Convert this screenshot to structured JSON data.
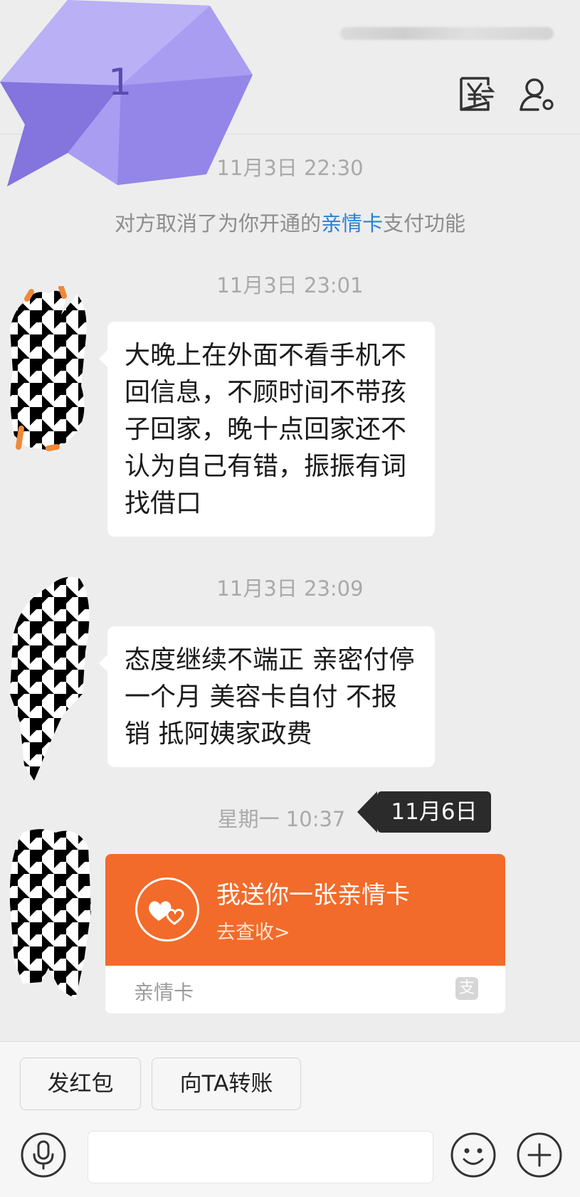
{
  "header": {
    "unread_count": "1",
    "transfer_icon": "yuan-transfer-icon",
    "profile_icon": "person-settings-icon"
  },
  "messages": [
    {
      "type": "timestamp",
      "text": "11月3日 22:30"
    },
    {
      "type": "system",
      "before": "对方取消了为你开通的",
      "link": "亲情卡",
      "after": "支付功能"
    },
    {
      "type": "timestamp",
      "text": "11月3日 23:01"
    },
    {
      "type": "text",
      "lines": [
        "大晚上在外面不看手机不",
        "回信息，不顾时间不带孩",
        "子回家，晚十点回家还不",
        "认为自己有错，振振有词",
        "找借口"
      ]
    },
    {
      "type": "timestamp",
      "text": "11月3日 23:09"
    },
    {
      "type": "text",
      "lines": [
        "态度继续不端正 亲密付停",
        "一个月   美容卡自付 不报",
        "销  抵阿姨家政费"
      ]
    },
    {
      "type": "timestamp",
      "text": "星期一 10:37"
    },
    {
      "type": "card",
      "title": "我送你一张亲情卡",
      "subtitle": "去查收>",
      "label": "亲情卡"
    }
  ],
  "tooltip": "11月6日",
  "bottom": {
    "red_packet_label": "发红包",
    "transfer_label": "向TA转账",
    "input_value": ""
  },
  "colors": {
    "card_orange": "#f26b2a",
    "link_blue": "#2b80d6",
    "badge_purple": "#8a7be6"
  }
}
